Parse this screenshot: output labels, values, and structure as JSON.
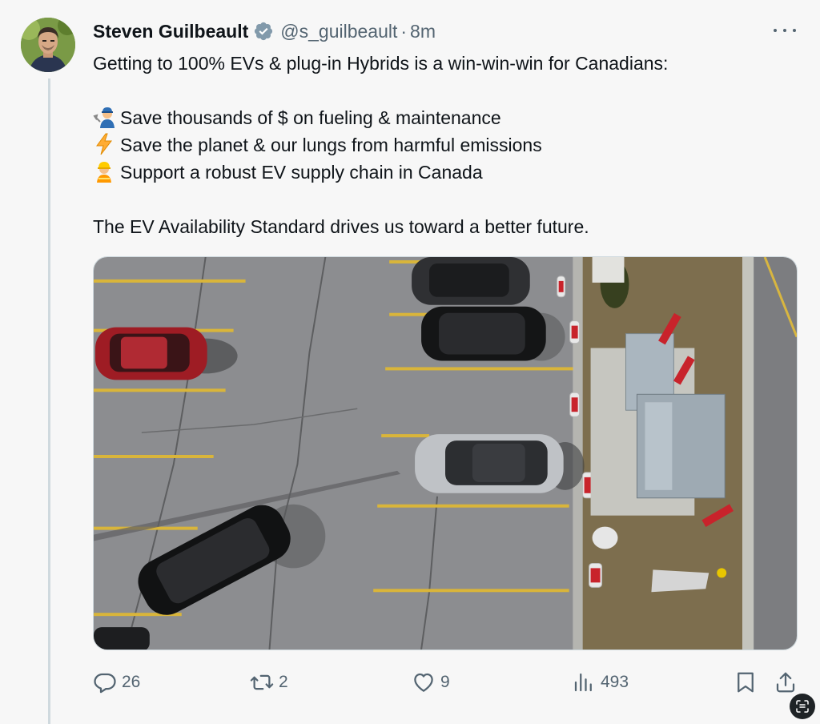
{
  "tweet": {
    "author": {
      "display_name": "Steven Guilbeault",
      "handle": "@s_guilbeault",
      "verified": true
    },
    "separator": "·",
    "time": "8m",
    "text": {
      "intro": "Getting to 100% EVs & plug-in Hybrids is a win-win-win for Canadians:",
      "bullets": [
        {
          "icon": "mechanic-emoji",
          "text": "Save thousands of $ on fueling & maintenance"
        },
        {
          "icon": "lightning-emoji",
          "text": "Save the planet & our lungs from harmful emissions"
        },
        {
          "icon": "construction-worker-emoji",
          "text": "Support a robust EV supply chain in Canada"
        }
      ],
      "closing": "The EV Availability Standard drives us toward a better future."
    },
    "media": {
      "kind": "photo",
      "subject": "aerial-parking-lot-ev-chargers"
    },
    "stats": {
      "replies": "26",
      "reposts": "2",
      "likes": "9",
      "views": "493"
    }
  },
  "colors": {
    "text": "#0f1419",
    "muted": "#536471",
    "verified_fill": "#829aab",
    "background": "#f7f7f7",
    "thread_line": "#cfd9de"
  }
}
